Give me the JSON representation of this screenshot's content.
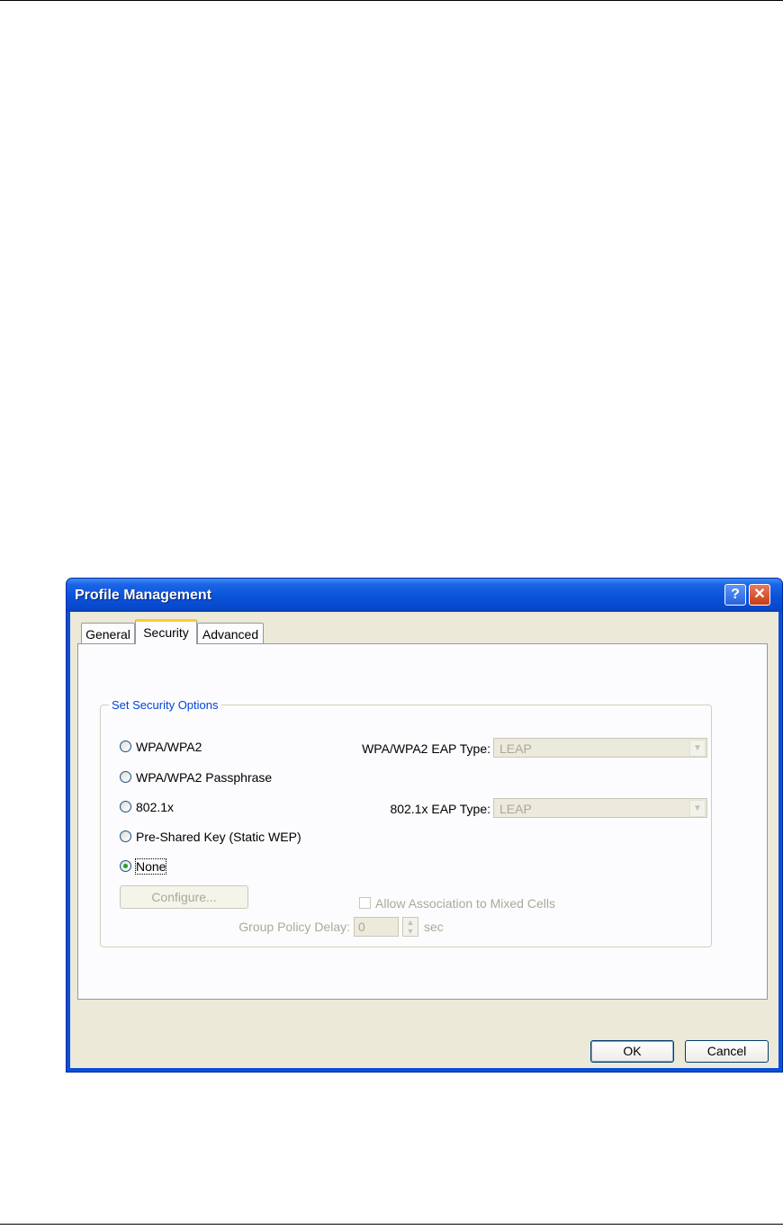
{
  "dialog": {
    "title": "Profile Management",
    "help_button": "?",
    "close_button": "✕"
  },
  "tabs": [
    {
      "label": "General"
    },
    {
      "label": "Security",
      "selected": true
    },
    {
      "label": "Advanced"
    }
  ],
  "security": {
    "group_title": "Set Security Options",
    "options": [
      {
        "label": "WPA/WPA2",
        "selected": false
      },
      {
        "label": "WPA/WPA2 Passphrase",
        "selected": false
      },
      {
        "label": "802.1x",
        "selected": false
      },
      {
        "label": "Pre-Shared Key (Static WEP)",
        "selected": false
      },
      {
        "label": "None",
        "selected": true
      }
    ],
    "wpa_eap_type_label": "WPA/WPA2 EAP Type:",
    "wpa_eap_type_value": "LEAP",
    "dot1x_eap_type_label": "802.1x EAP Type:",
    "dot1x_eap_type_value": "LEAP",
    "configure_button": "Configure...",
    "allow_mixed_cells_label": "Allow Association to Mixed Cells",
    "allow_mixed_cells_checked": false,
    "group_policy_delay_label": "Group Policy Delay:",
    "group_policy_delay_value": "0",
    "group_policy_delay_unit": "sec"
  },
  "footer": {
    "ok_label": "OK",
    "cancel_label": "Cancel"
  }
}
